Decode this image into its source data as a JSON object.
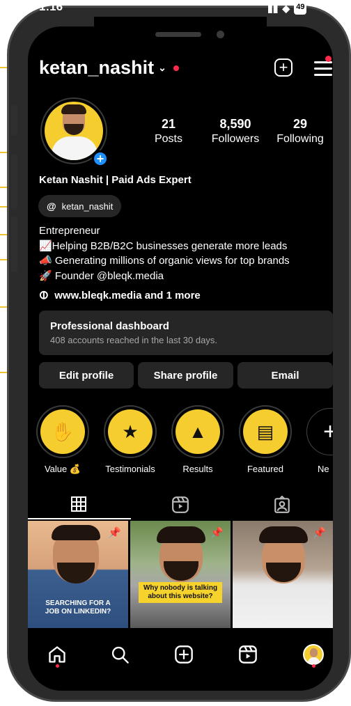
{
  "status_bar": {
    "time": "1:16",
    "battery": "49"
  },
  "profile": {
    "username": "ketan_nashit",
    "full_name": "Ketan Nashit | Paid Ads Expert",
    "threads_handle": "ketan_nashit",
    "bio_lines": [
      "Entrepreneur",
      "📈Helping B2B/B2C businesses generate more leads",
      "📣 Generating millions of organic views for top brands",
      "🚀 Founder @bleqk.media"
    ],
    "link_text": "www.bleqk.media and 1 more"
  },
  "stats": [
    {
      "value": "21",
      "label": "Posts"
    },
    {
      "value": "8,590",
      "label": "Followers"
    },
    {
      "value": "29",
      "label": "Following"
    }
  ],
  "dashboard": {
    "title": "Professional dashboard",
    "subtitle": "408 accounts reached in the last 30 days."
  },
  "actions": [
    {
      "label": "Edit profile"
    },
    {
      "label": "Share profile"
    },
    {
      "label": "Email"
    }
  ],
  "highlights": [
    {
      "label": "Value 💰",
      "icon": "diamond-hand-icon"
    },
    {
      "label": "Testimonials",
      "icon": "stars-person-icon"
    },
    {
      "label": "Results",
      "icon": "growth-chart-icon"
    },
    {
      "label": "Featured",
      "icon": "newspaper-icon"
    },
    {
      "label": "Ne",
      "icon": "plus-icon"
    }
  ],
  "posts": [
    {
      "caption": "SEARCHING FOR A JOB ON LINKEDIN?",
      "pinned": true
    },
    {
      "caption": "Why nobody is talking about this website?",
      "pinned": true
    },
    {
      "caption": "",
      "pinned": true
    }
  ],
  "colors": {
    "accent_red": "#ff2a4b",
    "brand_yellow": "#f6cd2f",
    "button_bg": "#262626",
    "badge_blue": "#1e90ff"
  }
}
